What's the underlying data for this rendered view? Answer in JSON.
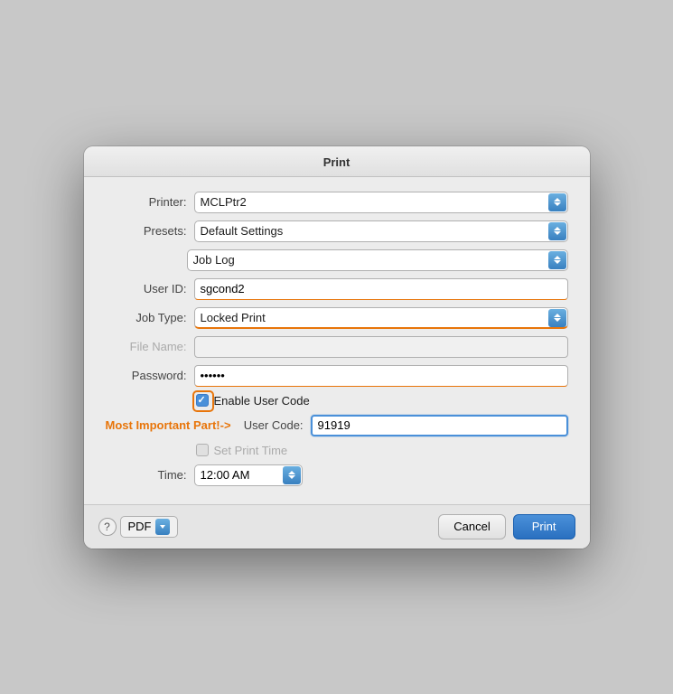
{
  "dialog": {
    "title": "Print",
    "printer_label": "Printer:",
    "printer_value": "MCLPtr2",
    "presets_label": "Presets:",
    "presets_value": "Default Settings",
    "section_value": "Job Log",
    "user_id_label": "User ID:",
    "user_id_value": "sgcond2",
    "job_type_label": "Job Type:",
    "job_type_value": "Locked Print",
    "file_name_label": "File Name:",
    "file_name_value": "",
    "password_label": "Password:",
    "password_value": "••••••",
    "enable_user_code_label": "Enable User Code",
    "most_important_label": "Most Important Part!->",
    "user_code_label": "User Code:",
    "user_code_value": "91919",
    "set_print_time_label": "Set Print Time",
    "time_label": "Time:",
    "time_value": "12:00 AM"
  },
  "footer": {
    "help_label": "?",
    "pdf_label": "PDF",
    "cancel_label": "Cancel",
    "print_label": "Print"
  }
}
